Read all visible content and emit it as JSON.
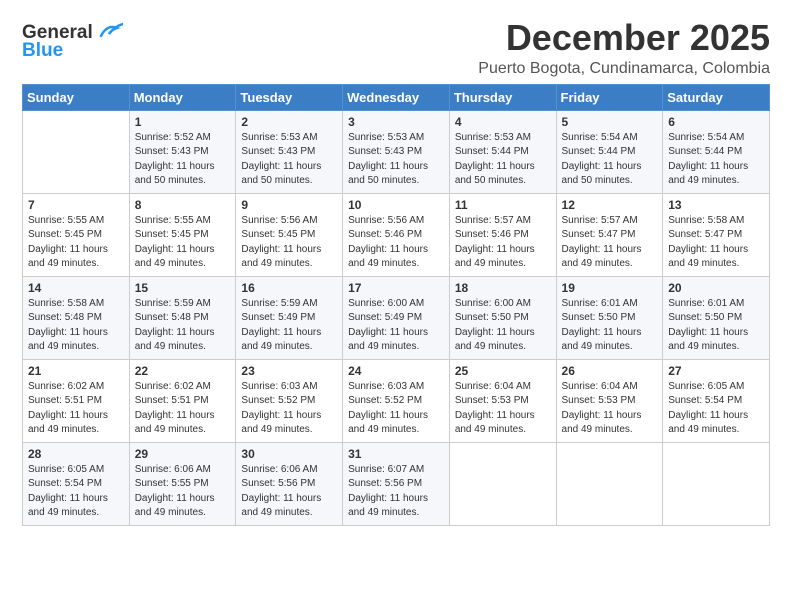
{
  "logo": {
    "line1": "General",
    "line2": "Blue"
  },
  "title": "December 2025",
  "subtitle": "Puerto Bogota, Cundinamarca, Colombia",
  "header": {
    "days": [
      "Sunday",
      "Monday",
      "Tuesday",
      "Wednesday",
      "Thursday",
      "Friday",
      "Saturday"
    ]
  },
  "weeks": [
    {
      "row_index": 0,
      "cells": [
        {
          "day": "",
          "info": ""
        },
        {
          "day": "1",
          "info": "Sunrise: 5:52 AM\nSunset: 5:43 PM\nDaylight: 11 hours\nand 50 minutes."
        },
        {
          "day": "2",
          "info": "Sunrise: 5:53 AM\nSunset: 5:43 PM\nDaylight: 11 hours\nand 50 minutes."
        },
        {
          "day": "3",
          "info": "Sunrise: 5:53 AM\nSunset: 5:43 PM\nDaylight: 11 hours\nand 50 minutes."
        },
        {
          "day": "4",
          "info": "Sunrise: 5:53 AM\nSunset: 5:44 PM\nDaylight: 11 hours\nand 50 minutes."
        },
        {
          "day": "5",
          "info": "Sunrise: 5:54 AM\nSunset: 5:44 PM\nDaylight: 11 hours\nand 50 minutes."
        },
        {
          "day": "6",
          "info": "Sunrise: 5:54 AM\nSunset: 5:44 PM\nDaylight: 11 hours\nand 49 minutes."
        }
      ]
    },
    {
      "row_index": 1,
      "cells": [
        {
          "day": "7",
          "info": "Sunrise: 5:55 AM\nSunset: 5:45 PM\nDaylight: 11 hours\nand 49 minutes."
        },
        {
          "day": "8",
          "info": "Sunrise: 5:55 AM\nSunset: 5:45 PM\nDaylight: 11 hours\nand 49 minutes."
        },
        {
          "day": "9",
          "info": "Sunrise: 5:56 AM\nSunset: 5:45 PM\nDaylight: 11 hours\nand 49 minutes."
        },
        {
          "day": "10",
          "info": "Sunrise: 5:56 AM\nSunset: 5:46 PM\nDaylight: 11 hours\nand 49 minutes."
        },
        {
          "day": "11",
          "info": "Sunrise: 5:57 AM\nSunset: 5:46 PM\nDaylight: 11 hours\nand 49 minutes."
        },
        {
          "day": "12",
          "info": "Sunrise: 5:57 AM\nSunset: 5:47 PM\nDaylight: 11 hours\nand 49 minutes."
        },
        {
          "day": "13",
          "info": "Sunrise: 5:58 AM\nSunset: 5:47 PM\nDaylight: 11 hours\nand 49 minutes."
        }
      ]
    },
    {
      "row_index": 2,
      "cells": [
        {
          "day": "14",
          "info": "Sunrise: 5:58 AM\nSunset: 5:48 PM\nDaylight: 11 hours\nand 49 minutes."
        },
        {
          "day": "15",
          "info": "Sunrise: 5:59 AM\nSunset: 5:48 PM\nDaylight: 11 hours\nand 49 minutes."
        },
        {
          "day": "16",
          "info": "Sunrise: 5:59 AM\nSunset: 5:49 PM\nDaylight: 11 hours\nand 49 minutes."
        },
        {
          "day": "17",
          "info": "Sunrise: 6:00 AM\nSunset: 5:49 PM\nDaylight: 11 hours\nand 49 minutes."
        },
        {
          "day": "18",
          "info": "Sunrise: 6:00 AM\nSunset: 5:50 PM\nDaylight: 11 hours\nand 49 minutes."
        },
        {
          "day": "19",
          "info": "Sunrise: 6:01 AM\nSunset: 5:50 PM\nDaylight: 11 hours\nand 49 minutes."
        },
        {
          "day": "20",
          "info": "Sunrise: 6:01 AM\nSunset: 5:50 PM\nDaylight: 11 hours\nand 49 minutes."
        }
      ]
    },
    {
      "row_index": 3,
      "cells": [
        {
          "day": "21",
          "info": "Sunrise: 6:02 AM\nSunset: 5:51 PM\nDaylight: 11 hours\nand 49 minutes."
        },
        {
          "day": "22",
          "info": "Sunrise: 6:02 AM\nSunset: 5:51 PM\nDaylight: 11 hours\nand 49 minutes."
        },
        {
          "day": "23",
          "info": "Sunrise: 6:03 AM\nSunset: 5:52 PM\nDaylight: 11 hours\nand 49 minutes."
        },
        {
          "day": "24",
          "info": "Sunrise: 6:03 AM\nSunset: 5:52 PM\nDaylight: 11 hours\nand 49 minutes."
        },
        {
          "day": "25",
          "info": "Sunrise: 6:04 AM\nSunset: 5:53 PM\nDaylight: 11 hours\nand 49 minutes."
        },
        {
          "day": "26",
          "info": "Sunrise: 6:04 AM\nSunset: 5:53 PM\nDaylight: 11 hours\nand 49 minutes."
        },
        {
          "day": "27",
          "info": "Sunrise: 6:05 AM\nSunset: 5:54 PM\nDaylight: 11 hours\nand 49 minutes."
        }
      ]
    },
    {
      "row_index": 4,
      "cells": [
        {
          "day": "28",
          "info": "Sunrise: 6:05 AM\nSunset: 5:54 PM\nDaylight: 11 hours\nand 49 minutes."
        },
        {
          "day": "29",
          "info": "Sunrise: 6:06 AM\nSunset: 5:55 PM\nDaylight: 11 hours\nand 49 minutes."
        },
        {
          "day": "30",
          "info": "Sunrise: 6:06 AM\nSunset: 5:56 PM\nDaylight: 11 hours\nand 49 minutes."
        },
        {
          "day": "31",
          "info": "Sunrise: 6:07 AM\nSunset: 5:56 PM\nDaylight: 11 hours\nand 49 minutes."
        },
        {
          "day": "",
          "info": ""
        },
        {
          "day": "",
          "info": ""
        },
        {
          "day": "",
          "info": ""
        }
      ]
    }
  ]
}
